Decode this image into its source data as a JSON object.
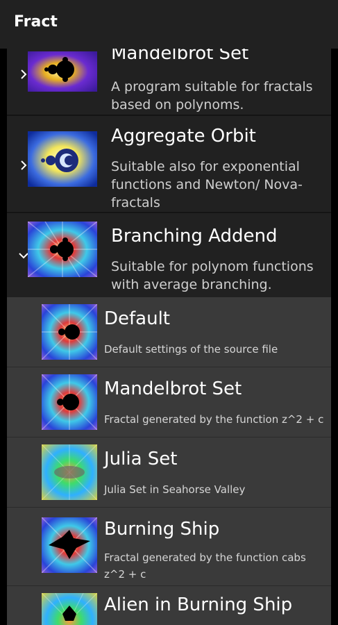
{
  "app": {
    "title": "Fract"
  },
  "groups": [
    {
      "name": "Mandelbrot Set",
      "description": "A program suitable for fractals based on polynoms.",
      "expanded": false
    },
    {
      "name": "Aggregate Orbit",
      "description": "Suitable also for exponential functions and Newton/ Nova-fractals",
      "expanded": false
    },
    {
      "name": "Branching Addend",
      "description": "Suitable for polynom functions with average branching.",
      "expanded": true
    }
  ],
  "children": [
    {
      "name": "Default",
      "description": "Default settings of the source file"
    },
    {
      "name": "Mandelbrot Set",
      "description": "Fractal generated by the function z^2 + c"
    },
    {
      "name": "Julia Set",
      "description": "Julia Set in Seahorse Valley"
    },
    {
      "name": "Burning Ship",
      "description": "Fractal generated by the function cabs z^2 + c"
    },
    {
      "name": "Alien in Burning Ship",
      "description": ""
    }
  ],
  "icons": {
    "collapsed": "chevron-right-icon",
    "expanded": "chevron-down-icon"
  }
}
